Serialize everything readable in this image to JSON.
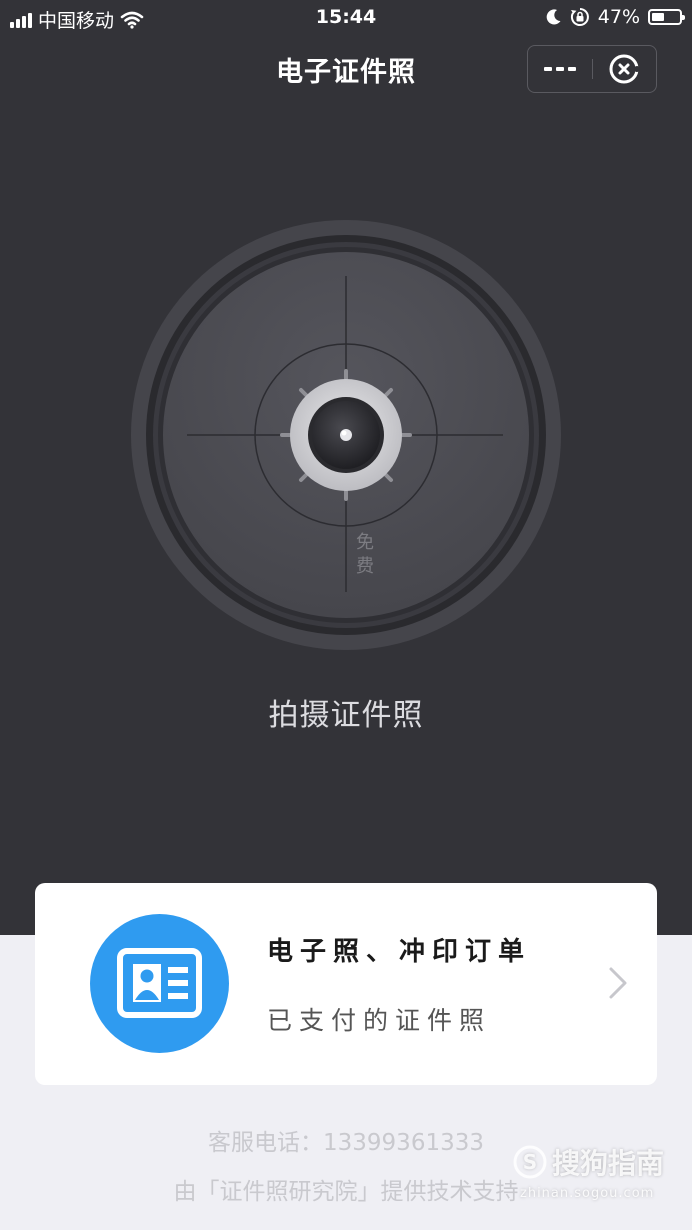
{
  "status_bar": {
    "carrier": "中国移动",
    "time": "15:44",
    "battery_percent": "47%",
    "battery_level": 0.47,
    "icons": [
      "signal-icon",
      "wifi-icon",
      "moon-icon",
      "rotation-lock-icon",
      "battery-icon"
    ]
  },
  "nav": {
    "title": "电子证件照",
    "icons": [
      "more-icon",
      "close-miniprogram-icon"
    ]
  },
  "camera": {
    "badge": "免\n费",
    "label": "拍摄证件照",
    "icons": [
      "camera-shutter-icon"
    ]
  },
  "orders_card": {
    "title": "电子照、冲印订单",
    "subtitle": "已支付的证件照",
    "icons": [
      "id-card-icon",
      "chevron-right-icon"
    ],
    "icon_color": "#2f9bf0"
  },
  "footer": {
    "phone": "客服电话：13399361333",
    "support": "由「证件照研究院」提供技术支持"
  },
  "watermark": {
    "brand": "搜狗指南",
    "url": "zhinan.sogou.com"
  },
  "colors": {
    "background_dark": "#333338",
    "background_light": "#efeff4",
    "accent": "#2f9bf0"
  }
}
